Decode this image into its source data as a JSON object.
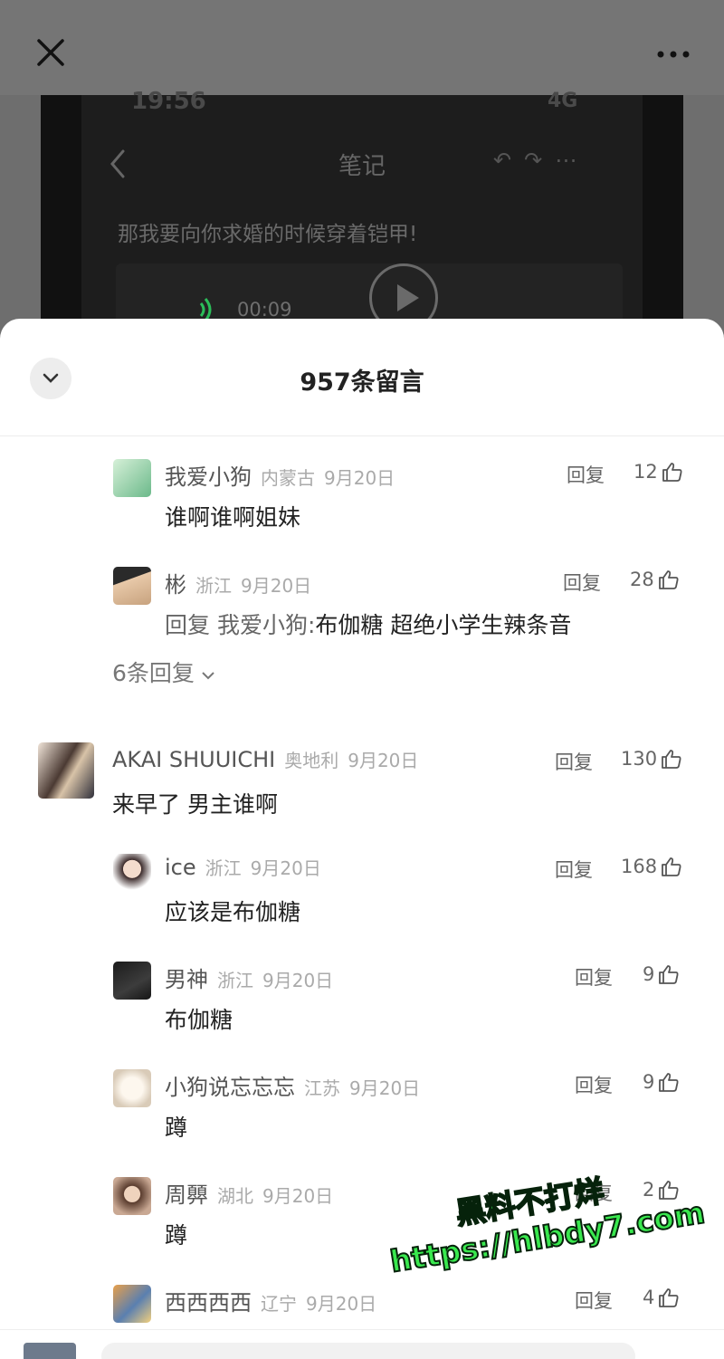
{
  "top": {
    "close_icon": "close-icon",
    "more_icon": "more-icon"
  },
  "video": {
    "status_time": "19:56",
    "status_network": "4G",
    "note_title": "笔记",
    "note_text": "那我要向你求婚的时候穿着铠甲!",
    "voice_duration": "00:09"
  },
  "sheet": {
    "title": "957条留言",
    "comments": [
      {
        "name": "我爱小狗",
        "location": "内蒙古",
        "date": "9月20日",
        "reply": "回复",
        "likes": "12",
        "text": "谁啊谁啊姐妹"
      },
      {
        "name": "彬",
        "location": "浙江",
        "date": "9月20日",
        "reply": "回复",
        "likes": "28",
        "reply_to": "回复 我爱小狗:",
        "text": "布伽糖 超绝小学生辣条音"
      },
      {
        "name": "AKAI SHUUICHI",
        "location": "奥地利",
        "date": "9月20日",
        "reply": "回复",
        "likes": "130",
        "text": "来早了 男主谁啊"
      },
      {
        "name": "ice",
        "location": "浙江",
        "date": "9月20日",
        "reply": "回复",
        "likes": "168",
        "text": "应该是布伽糖"
      },
      {
        "name": "男神",
        "location": "浙江",
        "date": "9月20日",
        "reply": "回复",
        "likes": "9",
        "text": "布伽糖"
      },
      {
        "name": "小狗说忘忘忘",
        "location": "江苏",
        "date": "9月20日",
        "reply": "回复",
        "likes": "9",
        "text": "蹲"
      },
      {
        "name": "周顨",
        "location": "湖北",
        "date": "9月20日",
        "reply": "回复",
        "likes": "2",
        "text": "蹲"
      },
      {
        "name": "西西西西",
        "location": "辽宁",
        "date": "9月20日",
        "reply": "回复",
        "likes": "4",
        "text": ""
      }
    ],
    "expand_replies": "6条回复"
  },
  "watermark": {
    "line1": "黑料不打烊",
    "line2": "https://hlbdy7.com"
  }
}
